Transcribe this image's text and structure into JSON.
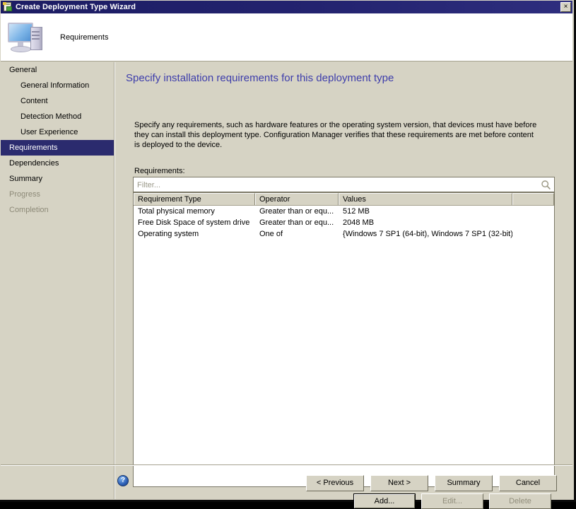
{
  "window": {
    "title": "Create Deployment Type Wizard",
    "title_icon": "wizard-app-icon",
    "close_label": "×",
    "close_icon": "close-icon"
  },
  "header": {
    "icon": "computer-icon",
    "title": "Requirements"
  },
  "sidebar": {
    "items": [
      {
        "label": "General",
        "indent": false,
        "selected": false,
        "disabled": false
      },
      {
        "label": "General Information",
        "indent": true,
        "selected": false,
        "disabled": false
      },
      {
        "label": "Content",
        "indent": true,
        "selected": false,
        "disabled": false
      },
      {
        "label": "Detection Method",
        "indent": true,
        "selected": false,
        "disabled": false
      },
      {
        "label": "User Experience",
        "indent": true,
        "selected": false,
        "disabled": false
      },
      {
        "label": "Requirements",
        "indent": false,
        "selected": true,
        "disabled": false
      },
      {
        "label": "Dependencies",
        "indent": false,
        "selected": false,
        "disabled": false
      },
      {
        "label": "Summary",
        "indent": false,
        "selected": false,
        "disabled": false
      },
      {
        "label": "Progress",
        "indent": false,
        "selected": false,
        "disabled": true
      },
      {
        "label": "Completion",
        "indent": false,
        "selected": false,
        "disabled": true
      }
    ]
  },
  "main": {
    "heading": "Specify installation requirements for this deployment type",
    "description": "Specify any requirements, such as hardware features or the operating system version, that devices must have before they can install this deployment type. Configuration Manager verifies that these requirements are met before content is deployed to the device.",
    "field_label": "Requirements:",
    "filter": {
      "value": "",
      "placeholder": "Filter...",
      "icon": "search-icon"
    },
    "table": {
      "columns": [
        "Requirement Type",
        "Operator",
        "Values",
        ""
      ],
      "rows": [
        {
          "requirement_type": "Total physical memory",
          "operator": "Greater than or equ...",
          "values": "512 MB",
          "extra": ""
        },
        {
          "requirement_type": "Free Disk Space of system drive",
          "operator": "Greater than or equ...",
          "values": "2048 MB",
          "extra": ""
        },
        {
          "requirement_type": "Operating system",
          "operator": "One of",
          "values": "{Windows 7 SP1 (64-bit), Windows 7 SP1 (32-bit)}",
          "extra": ""
        }
      ]
    },
    "list_buttons": {
      "add": "Add...",
      "edit": "Edit...",
      "delete": "Delete"
    }
  },
  "footer": {
    "help_icon": "help-icon",
    "help_glyph": "?",
    "previous": "< Previous",
    "next": "Next >",
    "summary": "Summary",
    "cancel": "Cancel"
  },
  "colors": {
    "titlebar": "#23236f",
    "dialog_face": "#d6d3c4",
    "heading_text": "#3d3dab",
    "selection": "#2b2b6e",
    "disabled_text": "#8d8a78"
  }
}
